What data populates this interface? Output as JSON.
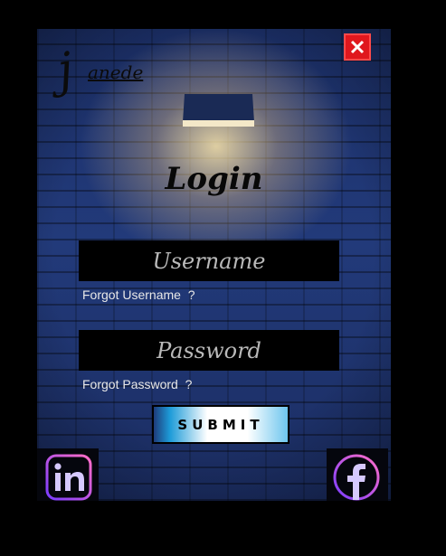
{
  "window": {
    "close_label": "✕"
  },
  "logo": {
    "initial": "j",
    "text": "anede"
  },
  "login": {
    "title": "Login"
  },
  "username": {
    "placeholder": "Username",
    "forgot": "Forgot Username  ?"
  },
  "password": {
    "placeholder": "Password",
    "forgot": "Forgot Password  ?"
  },
  "submit": {
    "label": "SUBMIT"
  },
  "social": {
    "linkedin": "in",
    "facebook": "f"
  },
  "colors": {
    "close": "#e0171d",
    "background": "#223a7a",
    "field": "#000000"
  }
}
